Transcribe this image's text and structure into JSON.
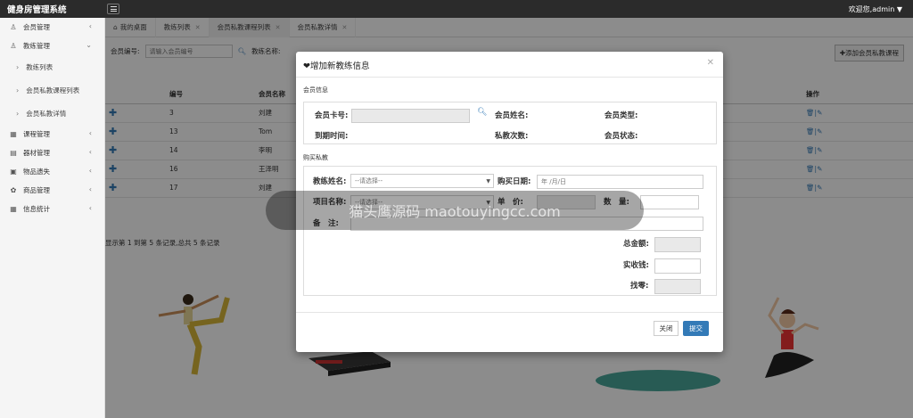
{
  "app": {
    "title": "健身房管理系统",
    "welcome": "欢迎您,admin ▼"
  },
  "sidebar": {
    "items": [
      {
        "label": "会员管理",
        "icon": "user-icon"
      },
      {
        "label": "教练管理",
        "icon": "user-group-icon"
      },
      {
        "label": "教练列表"
      },
      {
        "label": "会员私教课程列表"
      },
      {
        "label": "会员私教详情"
      },
      {
        "label": "课程管理",
        "icon": "calendar-icon"
      },
      {
        "label": "器材管理",
        "icon": "equipment-icon"
      },
      {
        "label": "物品遗失",
        "icon": "box-icon"
      },
      {
        "label": "商品管理",
        "icon": "shop-icon"
      },
      {
        "label": "信息统计",
        "icon": "grid-icon"
      }
    ]
  },
  "tabs": [
    {
      "label": "我的桌面"
    },
    {
      "label": "教练列表"
    },
    {
      "label": "会员私教课程列表"
    },
    {
      "label": "会员私教详情"
    }
  ],
  "filter": {
    "member_label": "会员编号:",
    "member_placeholder": "请输入会员编号",
    "coach_label": "教练名称:"
  },
  "add_button": "✚添加会员私教课程",
  "table": {
    "headers": [
      "",
      "编号",
      "会员名称",
      "操作"
    ],
    "rows": [
      {
        "id": "3",
        "name": "刘建"
      },
      {
        "id": "13",
        "name": "Tom"
      },
      {
        "id": "14",
        "name": "李明"
      },
      {
        "id": "16",
        "name": "王泽明"
      },
      {
        "id": "17",
        "name": "刘建"
      }
    ]
  },
  "pager_text": "显示第 1 到第 5 条记录,总共 5 条记录",
  "modal": {
    "title": "❤增加新教练信息",
    "section_member": "会员信息",
    "card_no_label": "会员卡号:",
    "member_name_label": "会员姓名:",
    "member_type_label": "会员类型:",
    "expire_label": "到期时间:",
    "sessions_label": "私教次数:",
    "status_label": "会员状态:",
    "section_buy": "购买私教",
    "coach_label": "教练姓名:",
    "coach_placeholder": "--请选择--",
    "date_label": "购买日期:",
    "date_placeholder": "年 /月/日",
    "project_label": "项目名称:",
    "project_placeholder": "--请选择--",
    "price_label": "单　价:",
    "qty_label": "数　量:",
    "remark_label": "备　注:",
    "total_label": "总金额:",
    "paid_label": "实收钱:",
    "change_label": "找零:",
    "close_btn": "关闭",
    "submit_btn": "提交"
  },
  "watermark": "猫头鹰源码 maotouyingcc.com",
  "colors": {
    "primary": "#337ab7",
    "topbar": "#2b2b2b"
  }
}
